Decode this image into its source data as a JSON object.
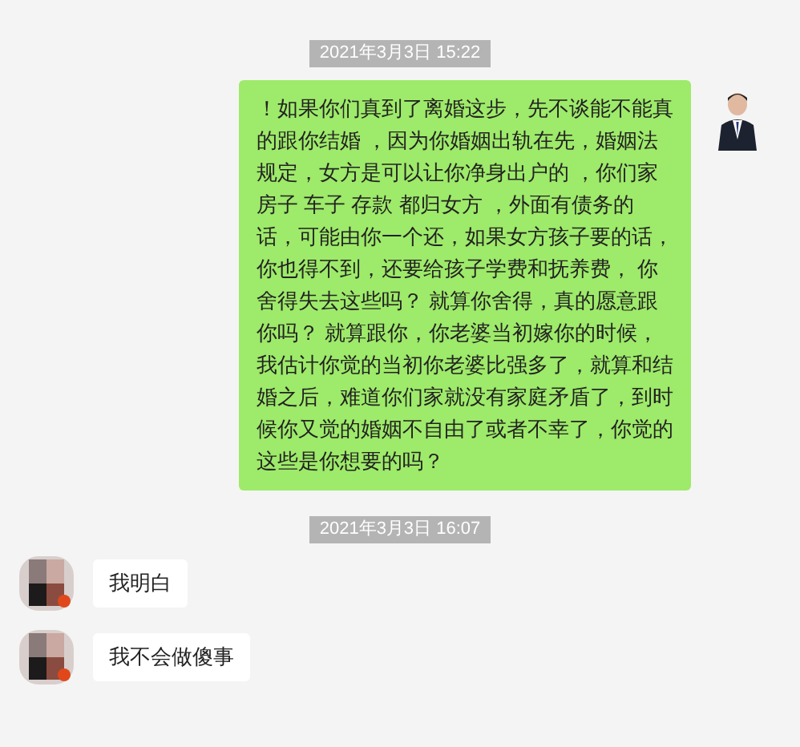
{
  "messages": [
    {
      "kind": "time",
      "text": "2021年3月3日 15:22"
    },
    {
      "kind": "sent",
      "text": "！如果你们真到了离婚这步，先不谈能不能真的跟你结婚 ，因为你婚姻出轨在先，婚姻法规定，女方是可以让你净身出户的 ，你们家房子 车子 存款 都归女方 ，外面有债务的话，可能由你一个还，如果女方孩子要的话，你也得不到，还要给孩子学费和抚养费， 你舍得失去这些吗？ 就算你舍得，真的愿意跟你吗？ 就算跟你，你老婆当初嫁你的时候，我估计你觉的当初你老婆比强多了，就算和结婚之后，难道你们家就没有家庭矛盾了，到时候你又觉的婚姻不自由了或者不幸了，你觉的这些是你想要的吗？"
    },
    {
      "kind": "time",
      "text": "2021年3月3日 16:07"
    },
    {
      "kind": "received",
      "text": "我明白"
    },
    {
      "kind": "received",
      "text": "我不会做傻事"
    }
  ]
}
